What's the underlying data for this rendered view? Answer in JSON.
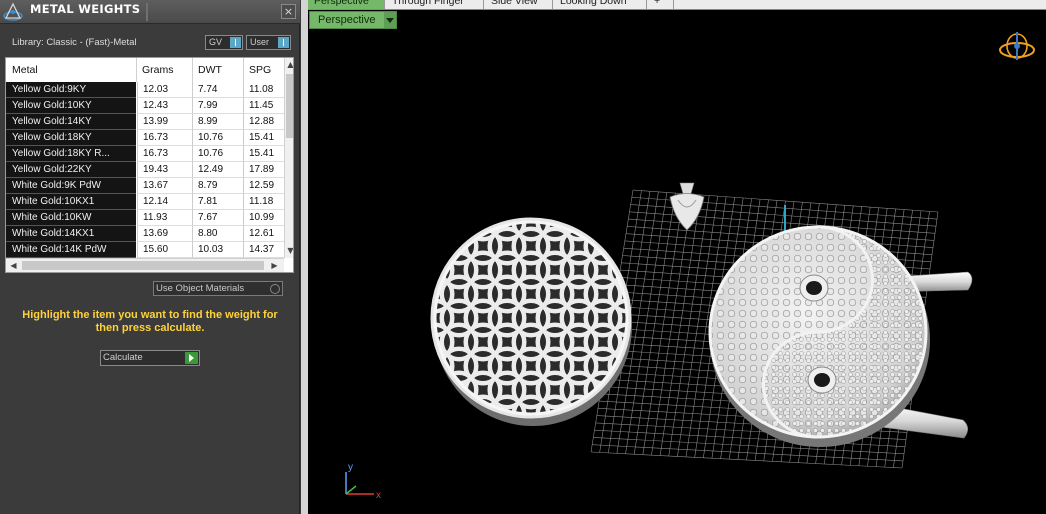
{
  "panel": {
    "title": "METAL WEIGHTS",
    "close": "×",
    "library_label": "Library: Classic - (Fast)-Metal",
    "toggles": {
      "gv": "GV",
      "user": "User"
    },
    "columns": [
      "Metal",
      "Grams",
      "DWT",
      "SPG"
    ],
    "rows": [
      {
        "metal": "Yellow Gold:9KY",
        "grams": "12.03",
        "dwt": "7.74",
        "spg": "11.08"
      },
      {
        "metal": "Yellow Gold:10KY",
        "grams": "12.43",
        "dwt": "7.99",
        "spg": "11.45"
      },
      {
        "metal": "Yellow Gold:14KY",
        "grams": "13.99",
        "dwt": "8.99",
        "spg": "12.88"
      },
      {
        "metal": "Yellow Gold:18KY",
        "grams": "16.73",
        "dwt": "10.76",
        "spg": "15.41"
      },
      {
        "metal": "Yellow Gold:18KY R...",
        "grams": "16.73",
        "dwt": "10.76",
        "spg": "15.41"
      },
      {
        "metal": "Yellow Gold:22KY",
        "grams": "19.43",
        "dwt": "12.49",
        "spg": "17.89"
      },
      {
        "metal": "White Gold:9K PdW",
        "grams": "13.67",
        "dwt": "8.79",
        "spg": "12.59"
      },
      {
        "metal": "White Gold:10KX1",
        "grams": "12.14",
        "dwt": "7.81",
        "spg": "11.18"
      },
      {
        "metal": "White Gold:10KW",
        "grams": "11.93",
        "dwt": "7.67",
        "spg": "10.99"
      },
      {
        "metal": "White Gold:14KX1",
        "grams": "13.69",
        "dwt": "8.80",
        "spg": "12.61"
      },
      {
        "metal": "White Gold:14K PdW",
        "grams": "15.60",
        "dwt": "10.03",
        "spg": "14.37"
      }
    ],
    "use_object_materials": "Use Object Materials",
    "hint": "Highlight the item you want to find the weight for then press calculate.",
    "calculate": "Calculate"
  },
  "viewport": {
    "tabs": [
      "Perspective",
      "Through Finger",
      "Side View",
      "Looking Down",
      "+"
    ],
    "active_tab": "Perspective",
    "view_dropdown": "Perspective",
    "axis_labels": {
      "y": "y",
      "x": "x"
    },
    "colors": {
      "active_tab": "#76b86a",
      "background": "#000000",
      "grid": "#8a8a8a",
      "gizmo": "#f0a020"
    }
  }
}
